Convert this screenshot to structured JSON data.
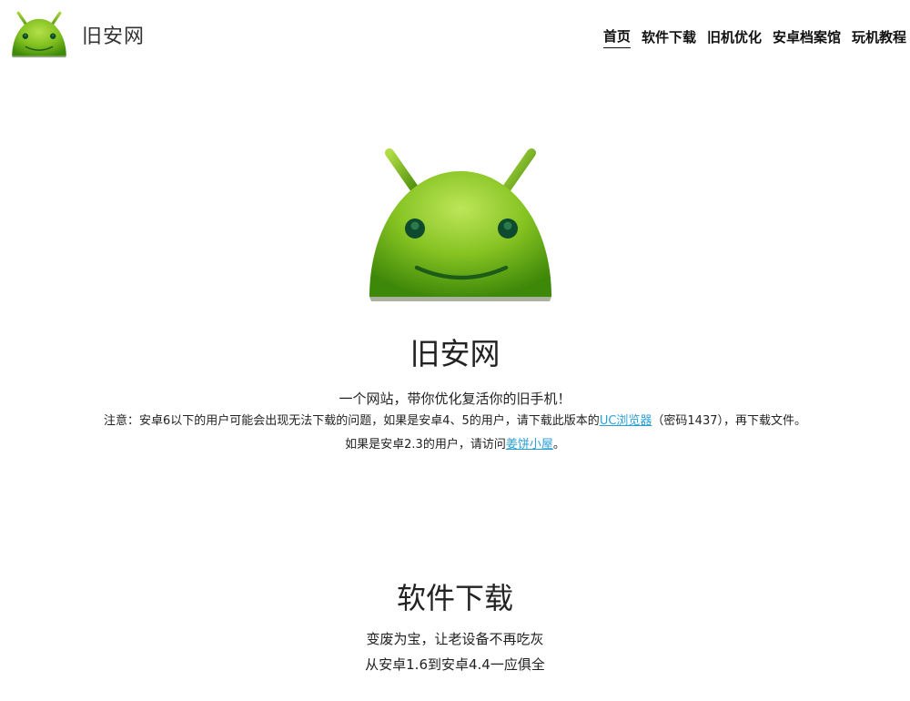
{
  "brand": {
    "name": "旧安网",
    "logo_icon": "android-head-icon"
  },
  "nav": {
    "items": [
      {
        "label": "首页",
        "active": true
      },
      {
        "label": "软件下载",
        "active": false
      },
      {
        "label": "旧机优化",
        "active": false
      },
      {
        "label": "安卓档案馆",
        "active": false
      },
      {
        "label": "玩机教程",
        "active": false
      }
    ]
  },
  "hero": {
    "logo_icon": "android-head-icon",
    "title": "旧安网",
    "subtitle": "一个网站，带你优化复活你的旧手机！",
    "note1": {
      "before": "注意：安卓6以下的用户可能会出现无法下载的问题，如果是安卓4、5的用户，请下载此版本的",
      "link": "UC浏览器",
      "after": "（密码1437），再下载文件。"
    },
    "note2": {
      "before": "如果是安卓2.3的用户，请访问",
      "link": "姜饼小屋",
      "after": "。"
    }
  },
  "section": {
    "title": "软件下载",
    "line1": "变废为宝，让老设备不再吃灰",
    "line2": "从安卓1.6到安卓4.4一应俱全"
  },
  "colors": {
    "android_green": "#8dc21f",
    "android_green_dark": "#4f8f0c",
    "link": "#2a9fd6",
    "text": "#222222"
  }
}
